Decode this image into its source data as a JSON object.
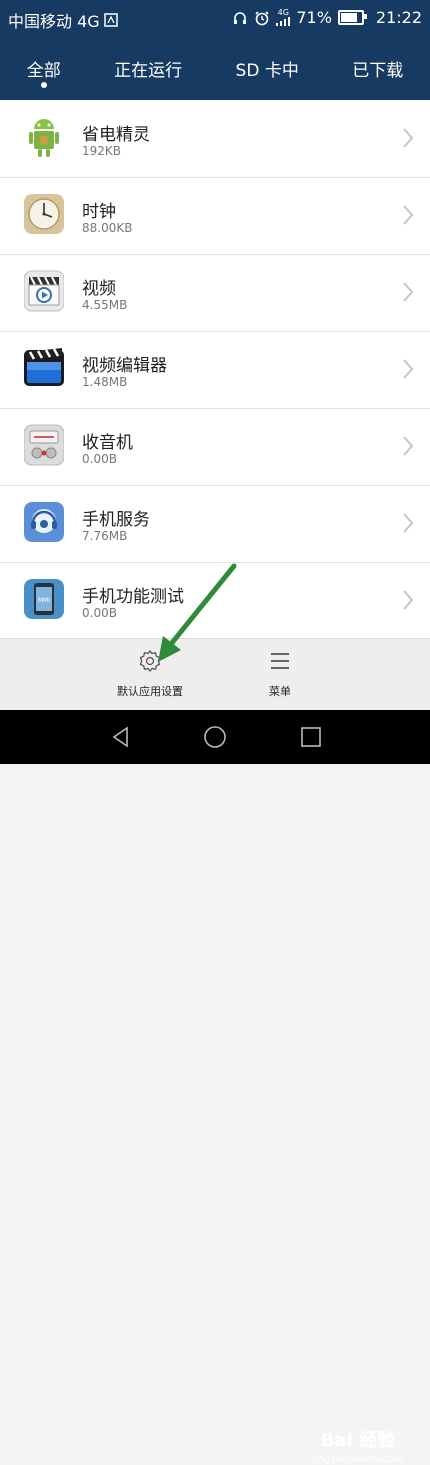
{
  "status_bar": {
    "carrier": "中国移动 4G",
    "network": "4G",
    "battery_percent": "71%",
    "time": "21:22",
    "battery_level": 0.71,
    "icons": [
      "sim-icon",
      "headset-icon",
      "alarm-icon",
      "signal-icon",
      "battery-icon"
    ]
  },
  "tabs": [
    {
      "label": "全部",
      "active": true
    },
    {
      "label": "正在运行",
      "active": false
    },
    {
      "label": "SD 卡中",
      "active": false
    },
    {
      "label": "已下载",
      "active": false
    }
  ],
  "apps": [
    {
      "name": "省电精灵",
      "size": "192KB",
      "icon": "android-icon"
    },
    {
      "name": "时钟",
      "size": "88.00KB",
      "icon": "clock-icon"
    },
    {
      "name": "视频",
      "size": "4.55MB",
      "icon": "video-icon"
    },
    {
      "name": "视频编辑器",
      "size": "1.48MB",
      "icon": "video-editor-icon"
    },
    {
      "name": "收音机",
      "size": "0.00B",
      "icon": "radio-icon"
    },
    {
      "name": "手机服务",
      "size": "7.76MB",
      "icon": "phone-service-icon"
    },
    {
      "name": "手机功能测试",
      "size": "0.00B",
      "icon": "mmi-test-icon"
    }
  ],
  "bottom_actions": {
    "default_settings": "默认应用设置",
    "menu": "菜单"
  },
  "mmi_label": "MMI",
  "watermark": {
    "title": "Bai 经验",
    "url": "jingyan.baidu.com"
  },
  "colors": {
    "header": "#173a63",
    "annotation_arrow": "#2e8b3a"
  }
}
